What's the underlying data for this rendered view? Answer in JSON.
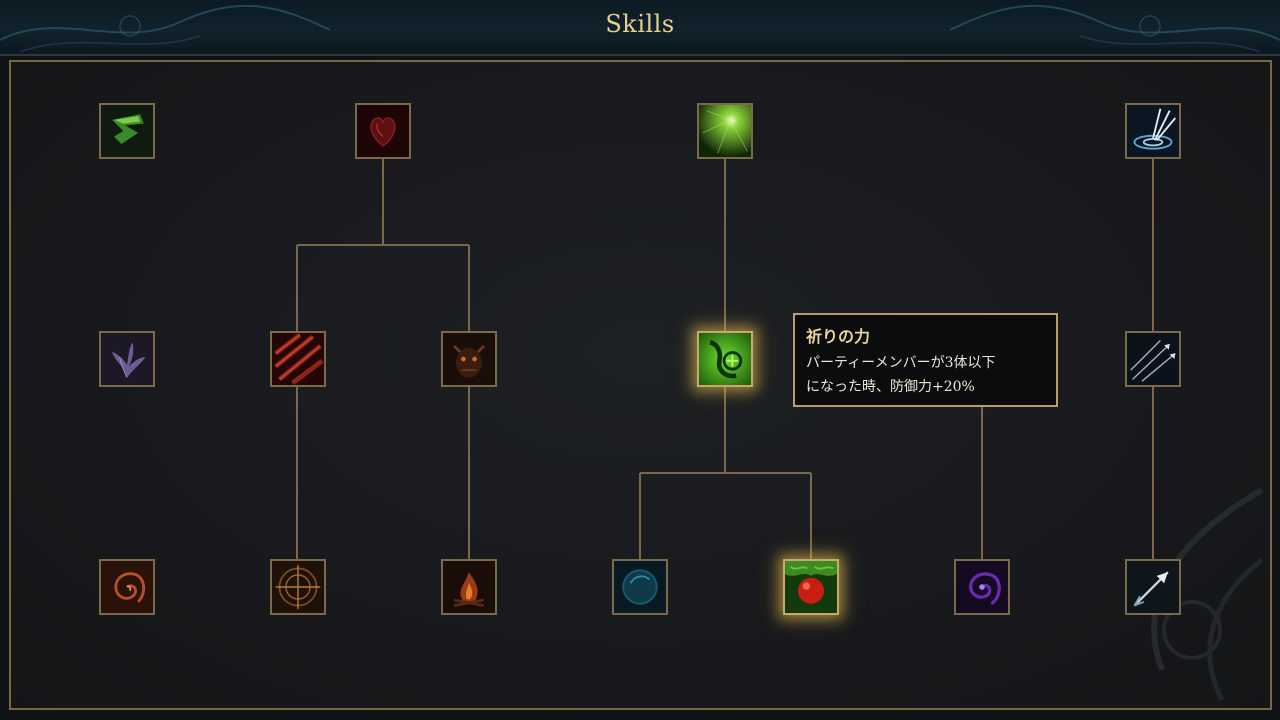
{
  "header": {
    "title": "Skills"
  },
  "tooltip": {
    "name": "祈りの力",
    "description_line1": "パーティーメンバーが3体以下",
    "description_line2": "になった時、防御力+20%"
  },
  "skills": [
    {
      "id": "skill-r1-c1",
      "icon": "green-swirl-icon",
      "row": 1,
      "col": 1
    },
    {
      "id": "skill-r1-c3",
      "icon": "red-heart-icon",
      "row": 1,
      "col": 3
    },
    {
      "id": "skill-r1-c5",
      "icon": "green-sunburst-icon",
      "row": 1,
      "col": 5
    },
    {
      "id": "skill-r1-c7",
      "icon": "target-burst-icon",
      "row": 1,
      "col": 7
    },
    {
      "id": "skill-r2-c1",
      "icon": "purple-lily-icon",
      "row": 2,
      "col": 1
    },
    {
      "id": "skill-r2-c2",
      "icon": "red-claw-slash-icon",
      "row": 2,
      "col": 2
    },
    {
      "id": "skill-r2-c3",
      "icon": "demon-face-icon",
      "row": 2,
      "col": 3
    },
    {
      "id": "skill-r2-c5",
      "icon": "prayer-hand-icon",
      "row": 2,
      "col": 5,
      "active": true
    },
    {
      "id": "skill-r2-c7",
      "icon": "arrow-volley-icon",
      "row": 2,
      "col": 7
    },
    {
      "id": "skill-r3-c1",
      "icon": "fire-swirl-icon",
      "row": 3,
      "col": 1
    },
    {
      "id": "skill-r3-c2",
      "icon": "rune-circle-icon",
      "row": 3,
      "col": 2
    },
    {
      "id": "skill-r3-c3",
      "icon": "campfire-icon",
      "row": 3,
      "col": 3
    },
    {
      "id": "skill-r3-c4",
      "icon": "water-orb-icon",
      "row": 3,
      "col": 4
    },
    {
      "id": "skill-r3-c5",
      "icon": "red-apple-icon",
      "row": 3,
      "col": 5,
      "active": true
    },
    {
      "id": "skill-r3-c6",
      "icon": "purple-vortex-icon",
      "row": 3,
      "col": 6
    },
    {
      "id": "skill-r3-c7",
      "icon": "piercing-arrow-icon",
      "row": 3,
      "col": 7
    }
  ],
  "colors": {
    "accent_gold": "#c9a868",
    "line_bronze": "#7c6848",
    "title_gold": "#e8cf8e",
    "header_teal": "#10222c"
  }
}
